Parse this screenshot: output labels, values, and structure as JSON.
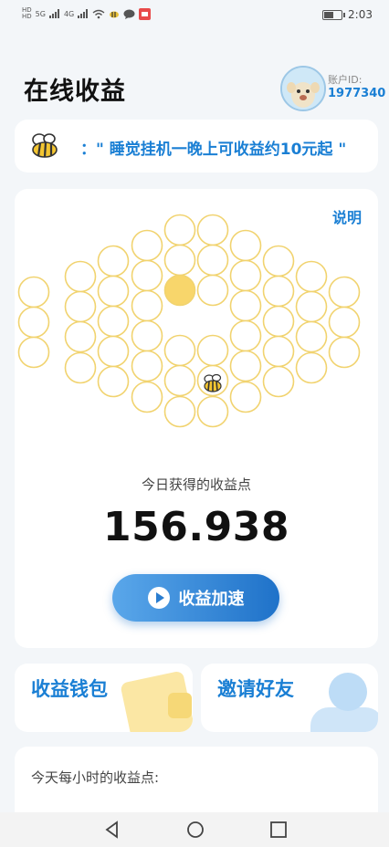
{
  "status_bar": {
    "hd1": "HD",
    "hd2": "HD",
    "net_5g": "5G",
    "net_4g": "4G",
    "time": "2:03",
    "battery_level": 0.5
  },
  "header": {
    "title": "在线收益",
    "account_label": "账户ID:",
    "account_id": "1977340"
  },
  "banner": {
    "text": "：\" 睡觉挂机一晚上可收益约10元起 \""
  },
  "main": {
    "explain_label": "说明",
    "today_label": "今日获得的收益点",
    "points": "156.938",
    "boost_label": "收益加速"
  },
  "tiles": {
    "wallet_label": "收益钱包",
    "invite_label": "邀请好友"
  },
  "hourly": {
    "label": "今天每小时的收益点:"
  },
  "colors": {
    "accent": "#1a7fd4",
    "honey": "#f8d66b",
    "cell_stroke": "#f1d36f"
  }
}
